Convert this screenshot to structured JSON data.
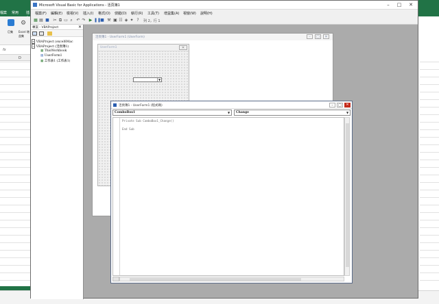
{
  "excel": {
    "tabs": [
      "檔案",
      "常用",
      "插入"
    ],
    "ribbon_labels": [
      "巨集",
      "Excel 增益集"
    ],
    "col_header": "D",
    "formula_icon": "fx"
  },
  "vbe": {
    "title": "Microsoft Visual Basic for Applications - 活頁簿1",
    "menu": [
      "檔案(F)",
      "編輯(E)",
      "檢視(V)",
      "插入(I)",
      "格式(O)",
      "偵錯(D)",
      "執行(R)",
      "工具(T)",
      "增益集(A)",
      "視窗(W)",
      "說明(H)"
    ],
    "toolbar_position": "列 2，行 1",
    "win_controls": [
      "–",
      "□",
      "✕"
    ]
  },
  "project": {
    "title": "專案 - VBAProject",
    "tree": [
      {
        "text": "VBAProject (excel8Mac",
        "level": 0
      },
      {
        "text": "VBAProject (活頁簿1)",
        "level": 0
      },
      {
        "text": "ThisWorkbook",
        "level": 1
      },
      {
        "text": "UserForm1",
        "level": 1
      },
      {
        "text": "工作表1 (工作表1)",
        "level": 1
      }
    ]
  },
  "userform_designer": {
    "title": "活頁簿1 - UserForm1 (UserForm)",
    "form_caption": "UserForm1"
  },
  "code_window": {
    "title": "活頁簿1 - UserForm1 (程式碼)",
    "object_dropdown": "ComboBox1",
    "procedure_dropdown": "Change",
    "lines": [
      "Private Sub ComboBox1_Change()",
      "",
      "End Sub"
    ]
  }
}
